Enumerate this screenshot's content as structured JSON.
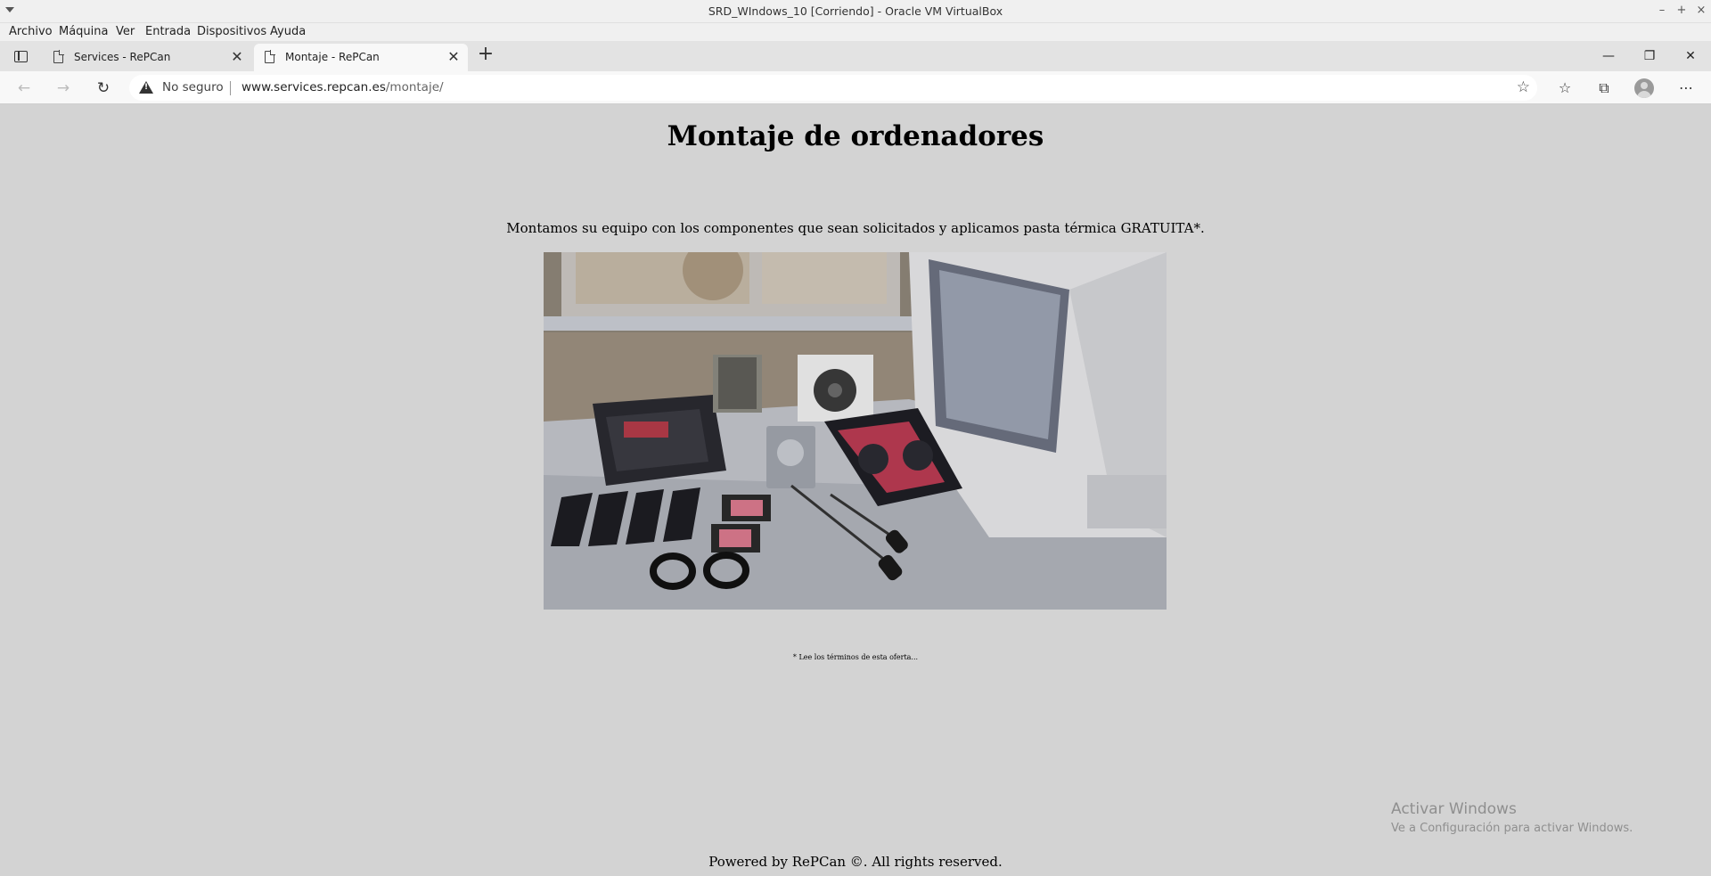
{
  "vm": {
    "title": "SRD_WIndows_10 [Corriendo] - Oracle VM VirtualBox",
    "menu": [
      "Archivo",
      "Máquina",
      "Ver",
      "Entrada",
      "Dispositivos",
      "Ayuda"
    ],
    "controls": [
      "–",
      "+",
      "×"
    ]
  },
  "browser": {
    "tabs": [
      {
        "label": "Services - RePCan",
        "active": false
      },
      {
        "label": "Montaje - RePCan",
        "active": true
      }
    ],
    "new_tab_symbol": "+",
    "window_controls": [
      "—",
      "❐",
      "✕"
    ],
    "security_label": "No seguro",
    "url_host": "www.services.repcan.es",
    "url_path": "/montaje/",
    "icons": [
      "tab-actions-icon",
      "back-icon",
      "forward-icon",
      "refresh-icon",
      "warning-icon",
      "add-favorite-icon",
      "favorites-icon",
      "collections-icon",
      "profile-avatar",
      "more-icon"
    ]
  },
  "page": {
    "heading": "Montaje de ordenadores",
    "intro": "Montamos su equipo con los componentes que sean solicitados y aplicamos pasta térmica GRATUITA*.",
    "note": "* Lee los términos de esta oferta...",
    "footer": "Powered by RePCan ©. All rights reserved.",
    "image_subject": "computer-assembly-components-photo"
  },
  "watermark": {
    "line1": "Activar Windows",
    "line2": "Ve a Configuración para activar Windows."
  },
  "colors": {
    "page_bg": "#d3d3d3",
    "toolbar_bg": "#f8f8f8",
    "tabstrip_bg": "#e3e3e3",
    "host_bg": "#f0f0f0"
  }
}
